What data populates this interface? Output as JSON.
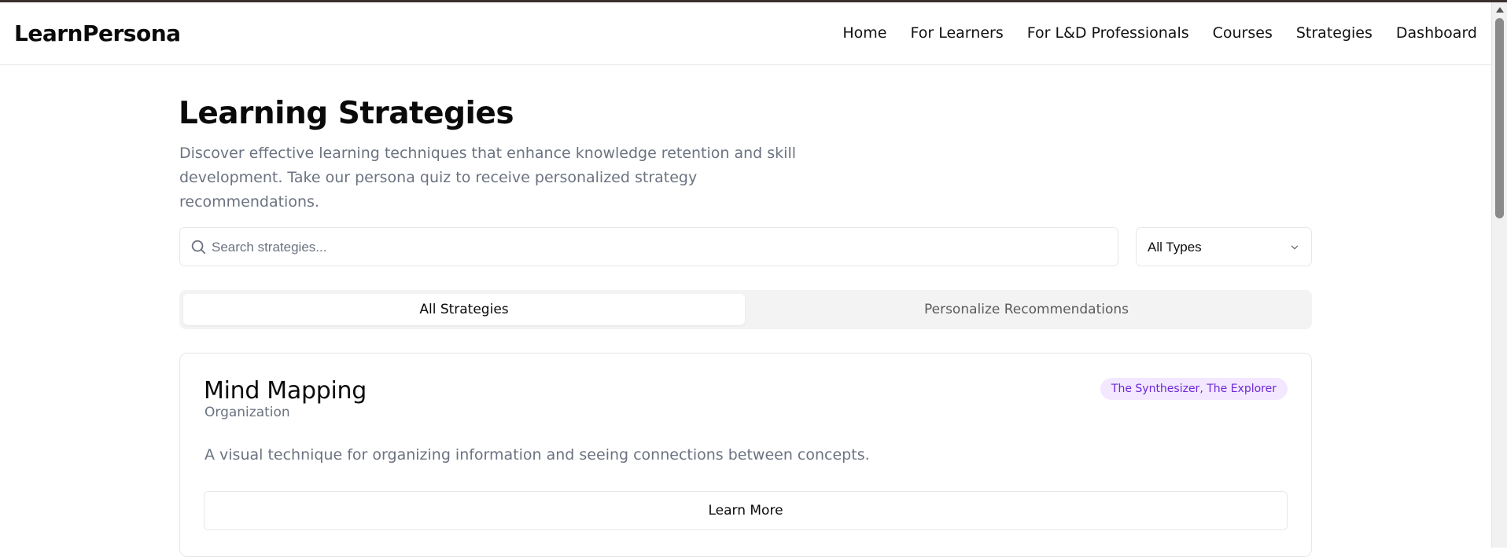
{
  "header": {
    "logo": "LearnPersona",
    "nav": [
      {
        "label": "Home"
      },
      {
        "label": "For Learners"
      },
      {
        "label": "For L&D Professionals"
      },
      {
        "label": "Courses"
      },
      {
        "label": "Strategies"
      },
      {
        "label": "Dashboard"
      }
    ]
  },
  "page": {
    "title": "Learning Strategies",
    "description": "Discover effective learning techniques that enhance knowledge retention and skill development. Take our persona quiz to receive personalized strategy recommendations."
  },
  "search": {
    "placeholder": "Search strategies...",
    "value": ""
  },
  "filter": {
    "selected": "All Types"
  },
  "tabs": [
    {
      "label": "All Strategies",
      "active": true
    },
    {
      "label": "Personalize Recommendations",
      "active": false
    }
  ],
  "strategies": [
    {
      "title": "Mind Mapping",
      "category": "Organization",
      "personas": "The Synthesizer, The Explorer",
      "description": "A visual technique for organizing information and seeing connections between concepts.",
      "action_label": "Learn More"
    }
  ],
  "colors": {
    "badge_bg": "#f3e8ff",
    "badge_text": "#6d28d9",
    "muted_text": "#6b7280",
    "border": "#e5e7eb"
  },
  "icons": {
    "search": "search-icon",
    "dropdown": "chevron-down-icon"
  }
}
